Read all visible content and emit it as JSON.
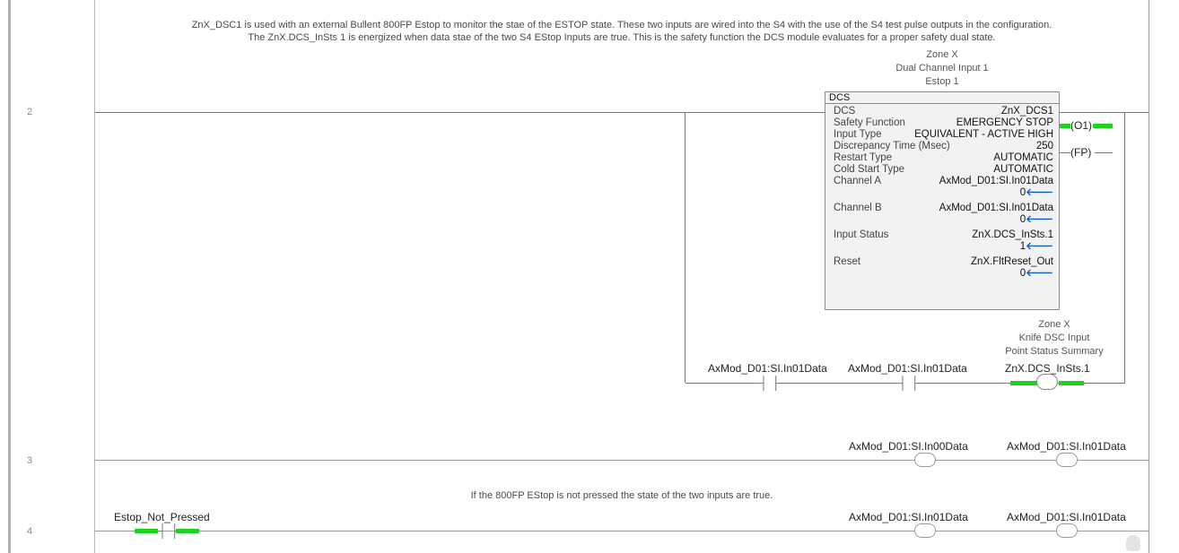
{
  "rungs": [
    {
      "number": "2"
    },
    {
      "number": "3"
    },
    {
      "number": "4"
    }
  ],
  "rung2": {
    "comment_line1": "ZnX_DSC1 is used with an external Bullent 800FP Estop to monitor the stae of the ESTOP state.  These two inputs are wired into the S4 with the use of the S4 test pulse outputs in the configuration.",
    "comment_line2": "The ZnX.DCS_InSts 1 is energized when data stae of the two S4 EStop Inputs are true.  This is the safety function the DCS module evaluates for a proper safety dual state.",
    "dcs_desc": [
      "Zone X",
      "Dual Channel Input 1",
      "Estop 1"
    ],
    "dcs_block": {
      "header": "DCS",
      "rows": [
        {
          "key": "DCS",
          "value": "ZnX_DCS1"
        },
        {
          "key": "Safety Function",
          "value": "EMERGENCY STOP"
        },
        {
          "key": "Input Type",
          "value": "EQUIVALENT - ACTIVE HIGH"
        },
        {
          "key": "Discrepancy Time (Msec)",
          "value": "250"
        },
        {
          "key": "Restart Type",
          "value": "AUTOMATIC"
        },
        {
          "key": "Cold Start Type",
          "value": "AUTOMATIC"
        },
        {
          "key": "Channel A",
          "value": "AxMod_D01:SI.In01Data",
          "live": "0"
        },
        {
          "key": "Channel B",
          "value": "AxMod_D01:SI.In01Data",
          "live": "0"
        },
        {
          "key": "Input Status",
          "value": "ZnX.DCS_InSts.1",
          "live": "1"
        },
        {
          "key": "Reset",
          "value": "ZnX.FltReset_Out",
          "live": "0"
        }
      ]
    },
    "output_o1": "O1",
    "output_fp": "FP",
    "contact_a": "AxMod_D01:SI.In01Data",
    "contact_b": "AxMod_D01:SI.In01Data",
    "coil_desc": [
      "Zone X",
      "Knife DSC Input",
      "Point Status Summary"
    ],
    "coil_tag": "ZnX.DCS_InSts.1"
  },
  "rung3": {
    "coil_a": "AxMod_D01:SI.In00Data",
    "coil_b": "AxMod_D01:SI.In01Data"
  },
  "rung4": {
    "comment": "If the 800FP EStop is not pressed the state of the two inputs are true.",
    "contact": "Estop_Not_Pressed",
    "coil_a": "AxMod_D01:SI.In01Data",
    "coil_b": "AxMod_D01:SI.In01Data"
  },
  "colors": {
    "energized": "#1dd31d",
    "live_arrow": "#1060c0",
    "block_bg": "#f2f2f2"
  }
}
